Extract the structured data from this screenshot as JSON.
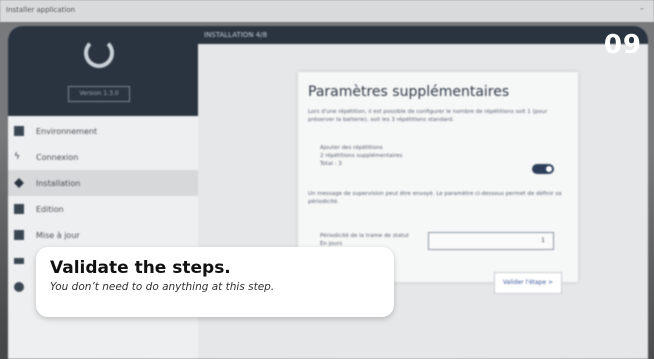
{
  "window": {
    "title": "Installer application"
  },
  "step_badge": "09",
  "app": {
    "version_label": "Version 1.3.0",
    "header_title": "INSTALLATION 4/8",
    "sidebar": {
      "items": [
        {
          "label": "Environnement",
          "icon": "grid-icon",
          "active": false
        },
        {
          "label": "Connexion",
          "icon": "plug-icon",
          "active": false
        },
        {
          "label": "Installation",
          "icon": "wrench-icon",
          "active": true
        },
        {
          "label": "Edition",
          "icon": "edit-icon",
          "active": false
        },
        {
          "label": "Mise à jour",
          "icon": "download-icon",
          "active": false
        },
        {
          "label": "",
          "icon": "sliders-icon",
          "active": false
        },
        {
          "label": "",
          "icon": "globe-icon",
          "active": false
        }
      ]
    },
    "card": {
      "title": "Paramètres supplémentaires",
      "intro": "Lors d'une répétition, il est possible de configurer le nombre de répétitions soit 1 (pour préserver la batterie), soit les 3 répétitions standard.",
      "repeat_label": "Ajouter des répétitions",
      "repeat_sub": "2 répétitions supplémentaires",
      "repeat_total": "Total : 3",
      "supervision_text": "Un message de supervision peut être envoyé. Le paramètre ci-dessous permet de définir sa périodicité.",
      "period_label": "Périodicité de la trame de statut",
      "period_unit": "En jours",
      "period_value": "1",
      "validate_button": "Valider l'étape >"
    }
  },
  "callout": {
    "title": "Validate the steps.",
    "subtitle": "You don’t need to do anything at this step."
  }
}
